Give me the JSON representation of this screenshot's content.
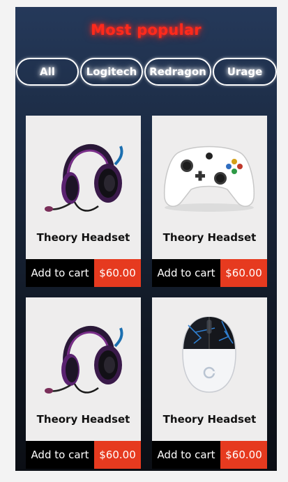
{
  "section": {
    "title": "Most popular"
  },
  "filters": [
    {
      "label": "All"
    },
    {
      "label": "Logitech"
    },
    {
      "label": "Redragon"
    },
    {
      "label": "Urage"
    }
  ],
  "products": [
    {
      "name": "Theory Headset",
      "cart_label": "Add to cart",
      "price": "$60.00",
      "image": "headset"
    },
    {
      "name": "Theory Headset",
      "cart_label": "Add to cart",
      "price": "$60.00",
      "image": "controller"
    },
    {
      "name": "Theory Headset",
      "cart_label": "Add to cart",
      "price": "$60.00",
      "image": "headset"
    },
    {
      "name": "Theory Headset",
      "cart_label": "Add to cart",
      "price": "$60.00",
      "image": "mouse"
    }
  ],
  "colors": {
    "title_glow": "#ff2a1c",
    "price_bg": "#e63a1f",
    "cart_bg": "#000000",
    "card_bg": "#eeeded"
  }
}
